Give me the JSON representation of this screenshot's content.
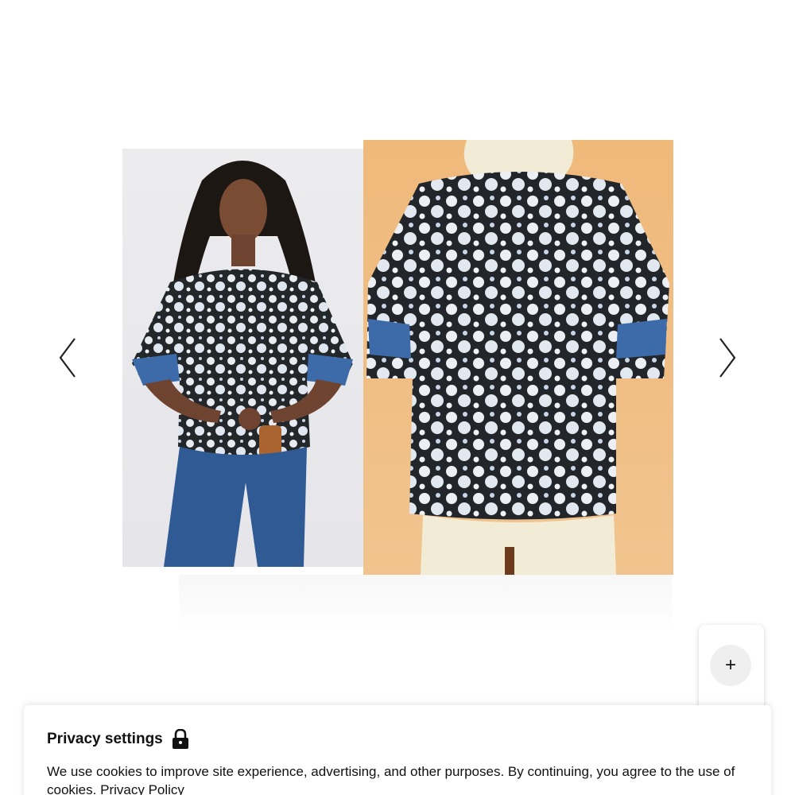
{
  "carousel": {
    "images": [
      {
        "alt": "model-photo"
      },
      {
        "alt": "mannequin-photo"
      }
    ]
  },
  "fab": {
    "label": "+"
  },
  "privacy": {
    "title": "Privacy settings",
    "text": "We use cookies to improve site experience, advertising, and other purposes. By continuing, you agree to the use of cookies.",
    "link_label": "Privacy Policy"
  },
  "colors": {
    "mannequin_background": "#efb97a",
    "model_background": "#e8e8ec",
    "print_dark": "#23272a",
    "print_light": "#e9edf2",
    "sleeve_blue": "#3d6aa8",
    "denim": "#2f5a94"
  },
  "icons": {
    "prev": "chevron-left-icon",
    "next": "chevron-right-icon",
    "lock": "lock-icon",
    "plus": "plus-icon"
  }
}
